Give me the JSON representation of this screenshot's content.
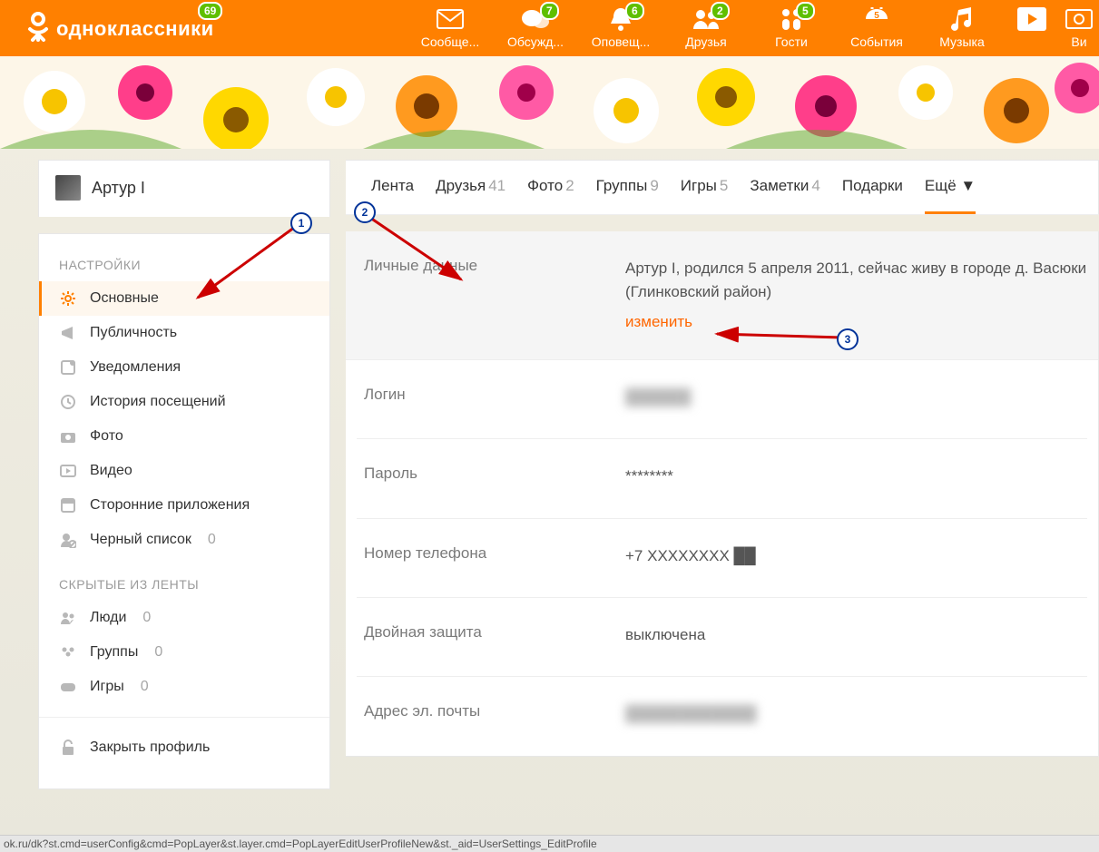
{
  "brand": "одноклассники",
  "brand_badge": "69",
  "topnav": [
    {
      "label": "Сообще...",
      "badge": null,
      "icon": "mail-icon"
    },
    {
      "label": "Обсужд...",
      "badge": "7",
      "icon": "discuss-icon"
    },
    {
      "label": "Оповещ...",
      "badge": "6",
      "icon": "bell-icon"
    },
    {
      "label": "Друзья",
      "badge": "2",
      "icon": "friends-icon"
    },
    {
      "label": "Гости",
      "badge": "5",
      "icon": "guests-icon"
    },
    {
      "label": "События",
      "badge": null,
      "icon": "events-icon"
    },
    {
      "label": "Музыка",
      "badge": null,
      "icon": "music-icon"
    },
    {
      "label": "",
      "badge": null,
      "icon": "play-icon"
    },
    {
      "label": "Ви",
      "badge": null,
      "icon": "video-top-icon"
    }
  ],
  "user": {
    "name": "Артур I"
  },
  "tabs": [
    {
      "label": "Лента",
      "count": ""
    },
    {
      "label": "Друзья",
      "count": "41"
    },
    {
      "label": "Фото",
      "count": "2"
    },
    {
      "label": "Группы",
      "count": "9"
    },
    {
      "label": "Игры",
      "count": "5"
    },
    {
      "label": "Заметки",
      "count": "4"
    },
    {
      "label": "Подарки",
      "count": ""
    },
    {
      "label": "Ещё ▼",
      "count": ""
    }
  ],
  "sidebar": {
    "settings_heading": "НАСТРОЙКИ",
    "hidden_heading": "СКРЫТЫЕ ИЗ ЛЕНТЫ",
    "items": [
      {
        "label": "Основные"
      },
      {
        "label": "Публичность"
      },
      {
        "label": "Уведомления"
      },
      {
        "label": "История посещений"
      },
      {
        "label": "Фото"
      },
      {
        "label": "Видео"
      },
      {
        "label": "Сторонние приложения"
      },
      {
        "label": "Черный список",
        "count": "0"
      }
    ],
    "hidden": [
      {
        "label": "Люди",
        "count": "0"
      },
      {
        "label": "Группы",
        "count": "0"
      },
      {
        "label": "Игры",
        "count": "0"
      }
    ],
    "lock": {
      "label": "Закрыть профиль"
    }
  },
  "settings": {
    "rows": [
      {
        "label": "Личные данные",
        "value": "Артур I, родился 5 апреля 2011, сейчас живу в городе д. Васюки (Глинковский район)",
        "change": "изменить"
      },
      {
        "label": "Логин",
        "value": "██████"
      },
      {
        "label": "Пароль",
        "value": "********"
      },
      {
        "label": "Номер телефона",
        "value": "+7 XXXXXXXX ██"
      },
      {
        "label": "Двойная защита",
        "value": "выключена"
      },
      {
        "label": "Адрес эл. почты",
        "value": "████████████"
      }
    ]
  },
  "annotations": {
    "m1": "1",
    "m2": "2",
    "m3": "3"
  },
  "status_url": "ok.ru/dk?st.cmd=userConfig&cmd=PopLayer&st.layer.cmd=PopLayerEditUserProfileNew&st._aid=UserSettings_EditProfile"
}
